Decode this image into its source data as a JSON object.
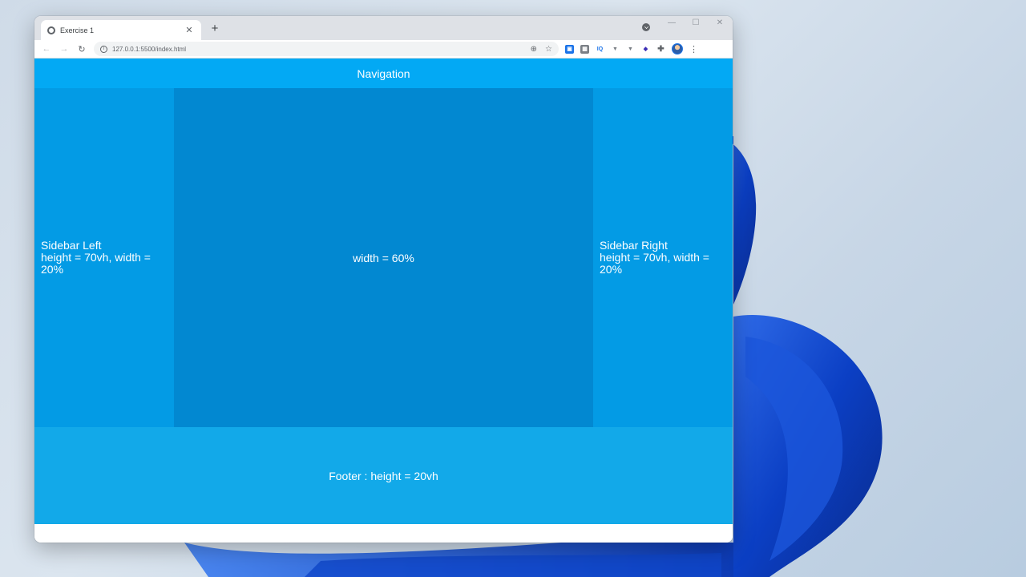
{
  "browser": {
    "tab_title": "Exercise 1",
    "new_tab_label": "+",
    "url": "127.0.0.1:5500/index.html"
  },
  "page": {
    "navigation": "Navigation",
    "sidebar_left_title": "Sidebar Left",
    "sidebar_left_desc": "height = 70vh, width = 20%",
    "main_text": "width = 60%",
    "sidebar_right_title": "Sidebar Right",
    "sidebar_right_desc": "height = 70vh, width = 20%",
    "footer_text": "Footer : height = 20vh"
  },
  "colors": {
    "navigation": "#03a9f4",
    "sidebar": "#039be5",
    "main": "#0288d1",
    "footer": "#12a9e9"
  },
  "icons": {
    "tab_favicon": "globe-icon",
    "back": "back-arrow-icon",
    "forward": "forward-arrow-icon",
    "reload": "reload-icon",
    "site_info": "info-icon",
    "zoom": "zoom-icon",
    "bookmark": "star-icon",
    "extensions": "puzzle-icon",
    "menu": "kebab-menu-icon"
  }
}
